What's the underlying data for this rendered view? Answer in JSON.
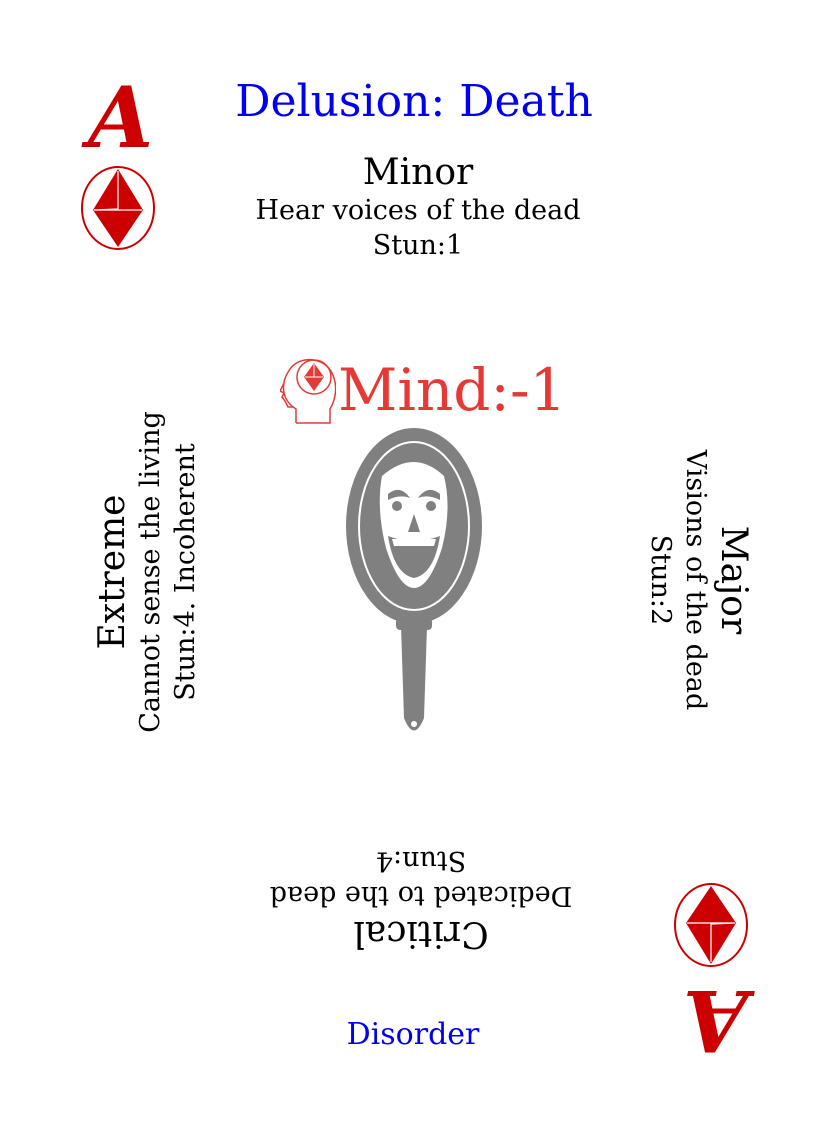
{
  "card": {
    "title": "Delusion: Death",
    "rank": "A",
    "suit_icon": "diamond-in-circle-icon",
    "footer": "Disorder",
    "colors": {
      "title": "#0000ee",
      "rank": "#cc0000",
      "mind": "#e53935",
      "art": "#808080"
    }
  },
  "stat": {
    "icon": "head-diamond-icon",
    "label": "Mind:-1"
  },
  "art": {
    "icon": "haunted-hand-mirror-icon"
  },
  "levels": {
    "minor": {
      "name": "Minor",
      "effect": "Hear voices of the dead",
      "stun": "Stun:1"
    },
    "major": {
      "name": "Major",
      "effect": "Visions of the dead",
      "stun": "Stun:2"
    },
    "critical": {
      "name": "Critical",
      "effect": "Dedicated to the dead",
      "stun": "Stun:4"
    },
    "extreme": {
      "name": "Extreme",
      "effect": "Cannot sense the living",
      "stun": "Stun:4. Incoherent"
    }
  }
}
